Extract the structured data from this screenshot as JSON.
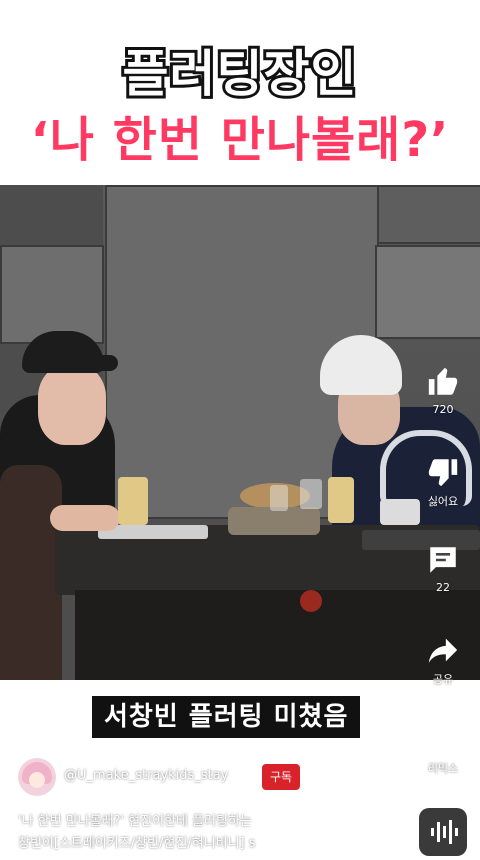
{
  "header": {
    "title_line1": "플러팅장인",
    "title_line2": "‘나 한번 만나볼래?’",
    "icons": [
      "back-arrow-icon",
      "search-icon",
      "camera-icon",
      "more-vert-icon"
    ]
  },
  "actions": {
    "like_count": "720",
    "dislike_label": "싫어요",
    "comment_count": "22",
    "share_label": "공유",
    "remix_label": "리믹스"
  },
  "video_caption": "서창빈 플러팅 미쳤음",
  "channel": {
    "handle": "@U_make_straykids_stay",
    "subscribe_label": "구독"
  },
  "description": {
    "line1": "'나 한번 만나볼래?' 현진이한테 플러팅하는",
    "line2": "창빈이[스트레이키즈/창빈/현진/혀니비니] s"
  },
  "colors": {
    "title_red": "#ff3a62",
    "subscribe_red": "#d8232a"
  }
}
